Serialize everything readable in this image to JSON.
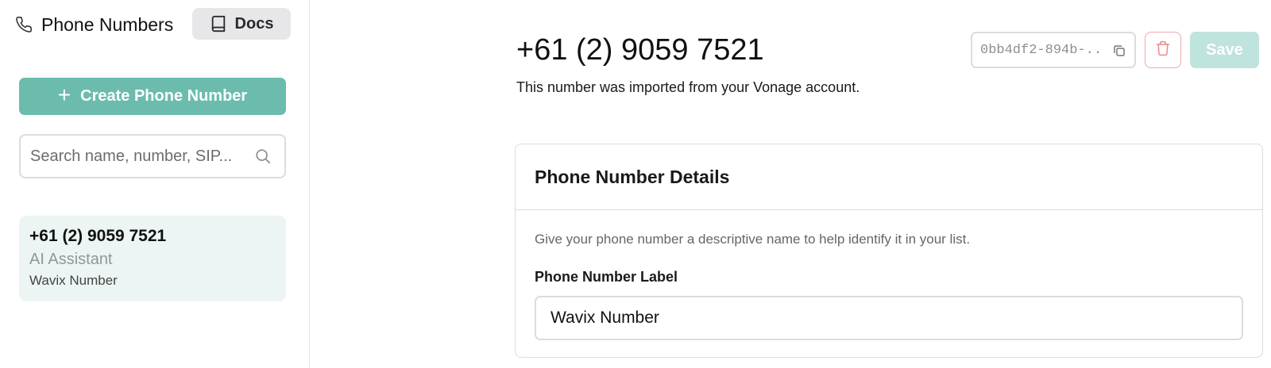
{
  "sidebar": {
    "title": "Phone Numbers",
    "docs_label": "Docs",
    "create_label": "Create Phone Number",
    "search": {
      "placeholder": "Search name, number, SIP...",
      "value": ""
    },
    "items": [
      {
        "number": "+61 (2) 9059 7521",
        "assistant": "AI Assistant",
        "label": "Wavix Number"
      }
    ]
  },
  "main": {
    "title": "+61 (2) 9059 7521",
    "subtitle": "This number was imported from your Vonage account.",
    "id_text": "0bb4df2-894b-..",
    "save_label": "Save",
    "card": {
      "title": "Phone Number Details",
      "description": "Give your phone number a descriptive name to help identify it in your list.",
      "field_label": "Phone Number Label",
      "field_value": "Wavix Number"
    }
  },
  "colors": {
    "accent": "#6bbcad",
    "accent_disabled": "#bfe3dd",
    "list_item_bg": "#ecf5f3",
    "danger": "#e88a8a"
  },
  "icons": [
    "phone-icon",
    "book-icon",
    "plus-icon",
    "search-icon",
    "copy-icon",
    "trash-icon"
  ]
}
